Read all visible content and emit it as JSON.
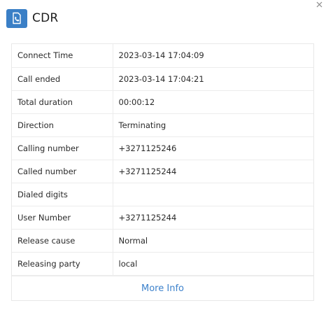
{
  "dialog": {
    "title": "CDR",
    "more_info_label": "More Info"
  },
  "rows": [
    {
      "label": "Connect Time",
      "value": "2023-03-14 17:04:09"
    },
    {
      "label": "Call ended",
      "value": "2023-03-14 17:04:21"
    },
    {
      "label": "Total duration",
      "value": "00:00:12"
    },
    {
      "label": "Direction",
      "value": "Terminating"
    },
    {
      "label": "Calling number",
      "value": "+3271125246"
    },
    {
      "label": "Called number",
      "value": "+3271125244"
    },
    {
      "label": "Dialed digits",
      "value": ""
    },
    {
      "label": "User Number",
      "value": "+3271125244"
    },
    {
      "label": "Release cause",
      "value": "Normal"
    },
    {
      "label": "Releasing party",
      "value": "local"
    }
  ],
  "icons": {
    "header": "phone-document-icon",
    "close": "close-icon"
  },
  "colors": {
    "accent": "#3a7fc6",
    "link": "#3d82cc"
  }
}
